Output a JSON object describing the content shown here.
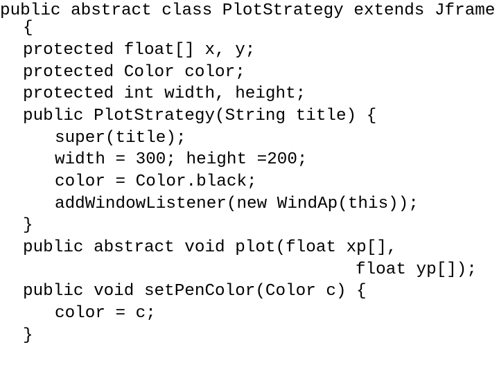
{
  "code": {
    "lines": [
      {
        "indent": 0,
        "text": "public abstract class PlotStrategy extends Jframe"
      },
      {
        "indent": 1,
        "text": "{"
      },
      {
        "indent": 1,
        "text": "protected float[] x, y;"
      },
      {
        "indent": 1,
        "text": "protected Color color;"
      },
      {
        "indent": 1,
        "text": "protected int width, height;"
      },
      {
        "indent": 1,
        "text": "public PlotStrategy(String title) {"
      },
      {
        "indent": 2,
        "text": "super(title);"
      },
      {
        "indent": 2,
        "text": "width = 300; height =200;"
      },
      {
        "indent": 2,
        "text": "color = Color.black;"
      },
      {
        "indent": 2,
        "text": "addWindowListener(new WindAp(this));"
      },
      {
        "indent": 1,
        "text": "}"
      },
      {
        "indent": 1,
        "text": "public abstract void plot(float xp[],"
      },
      {
        "indent": 3,
        "text": "float yp[]);"
      },
      {
        "indent": 1,
        "text": "public void setPenColor(Color c) {"
      },
      {
        "indent": 2,
        "text": "color = c;"
      },
      {
        "indent": 1,
        "text": "}"
      }
    ]
  }
}
